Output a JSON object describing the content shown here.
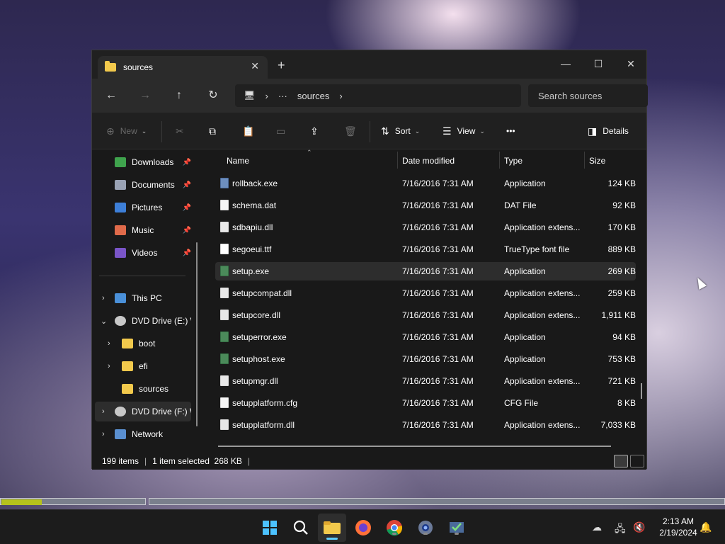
{
  "window": {
    "tab_title": "sources",
    "new_tab": "+",
    "minimize": "—",
    "maximize": "☐",
    "close": "✕"
  },
  "address": {
    "computer_icon": "computer-icon",
    "ellipsis": "···",
    "crumb": "sources",
    "search_placeholder": "Search sources"
  },
  "toolbar": {
    "new": "New",
    "sort": "Sort",
    "view": "View",
    "more": "•••",
    "details": "Details"
  },
  "sidebar": {
    "quick_access": [
      {
        "label": "Downloads",
        "icon": "download-icon",
        "color": "#3fa34d"
      },
      {
        "label": "Documents",
        "icon": "document-icon",
        "color": "#9aa3b5"
      },
      {
        "label": "Pictures",
        "icon": "picture-icon",
        "color": "#3d7fd8"
      },
      {
        "label": "Music",
        "icon": "music-icon",
        "color": "#e06a4a"
      },
      {
        "label": "Videos",
        "icon": "video-icon",
        "color": "#7a55c8"
      }
    ],
    "tree": [
      {
        "label": "This PC",
        "icon": "computer-icon"
      },
      {
        "label": "DVD Drive (E:) W",
        "icon": "dvd-icon"
      },
      {
        "label": "boot",
        "icon": "folder-icon"
      },
      {
        "label": "efi",
        "icon": "folder-icon"
      },
      {
        "label": "sources",
        "icon": "folder-icon"
      },
      {
        "label": "DVD Drive (F:) W",
        "icon": "dvd-icon"
      },
      {
        "label": "Network",
        "icon": "network-icon"
      }
    ]
  },
  "columns": {
    "name": "Name",
    "date": "Date modified",
    "type": "Type",
    "size": "Size"
  },
  "files": [
    {
      "name": "rollback.exe",
      "date": "7/16/2016 7:31 AM",
      "type": "Application",
      "size": "124 KB",
      "icon": "app"
    },
    {
      "name": "schema.dat",
      "date": "7/16/2016 7:31 AM",
      "type": "DAT File",
      "size": "92 KB",
      "icon": "file"
    },
    {
      "name": "sdbapiu.dll",
      "date": "7/16/2016 7:31 AM",
      "type": "Application extens...",
      "size": "170 KB",
      "icon": "dll"
    },
    {
      "name": "segoeui.ttf",
      "date": "7/16/2016 7:31 AM",
      "type": "TrueType font file",
      "size": "889 KB",
      "icon": "font"
    },
    {
      "name": "setup.exe",
      "date": "7/16/2016 7:31 AM",
      "type": "Application",
      "size": "269 KB",
      "icon": "exe2"
    },
    {
      "name": "setupcompat.dll",
      "date": "7/16/2016 7:31 AM",
      "type": "Application extens...",
      "size": "259 KB",
      "icon": "dll"
    },
    {
      "name": "setupcore.dll",
      "date": "7/16/2016 7:31 AM",
      "type": "Application extens...",
      "size": "1,911 KB",
      "icon": "dll"
    },
    {
      "name": "setuperror.exe",
      "date": "7/16/2016 7:31 AM",
      "type": "Application",
      "size": "94 KB",
      "icon": "exe2"
    },
    {
      "name": "setuphost.exe",
      "date": "7/16/2016 7:31 AM",
      "type": "Application",
      "size": "753 KB",
      "icon": "exe2"
    },
    {
      "name": "setupmgr.dll",
      "date": "7/16/2016 7:31 AM",
      "type": "Application extens...",
      "size": "721 KB",
      "icon": "dll"
    },
    {
      "name": "setupplatform.cfg",
      "date": "7/16/2016 7:31 AM",
      "type": "CFG File",
      "size": "8 KB",
      "icon": "file"
    },
    {
      "name": "setupplatform.dll",
      "date": "7/16/2016 7:31 AM",
      "type": "Application extens...",
      "size": "7,033 KB",
      "icon": "dll"
    }
  ],
  "selected_file": "setup.exe",
  "status": {
    "items": "199 items",
    "selected": "1 item selected  268 KB"
  },
  "progress": {
    "fraction": 0.28,
    "color": "#b5c21c"
  },
  "taskbar": {
    "time": "2:13 AM",
    "date": "2/19/2024"
  },
  "colors": {
    "window_bg": "#191919",
    "accent": "#60cdff",
    "folder": "#f2c94c"
  }
}
